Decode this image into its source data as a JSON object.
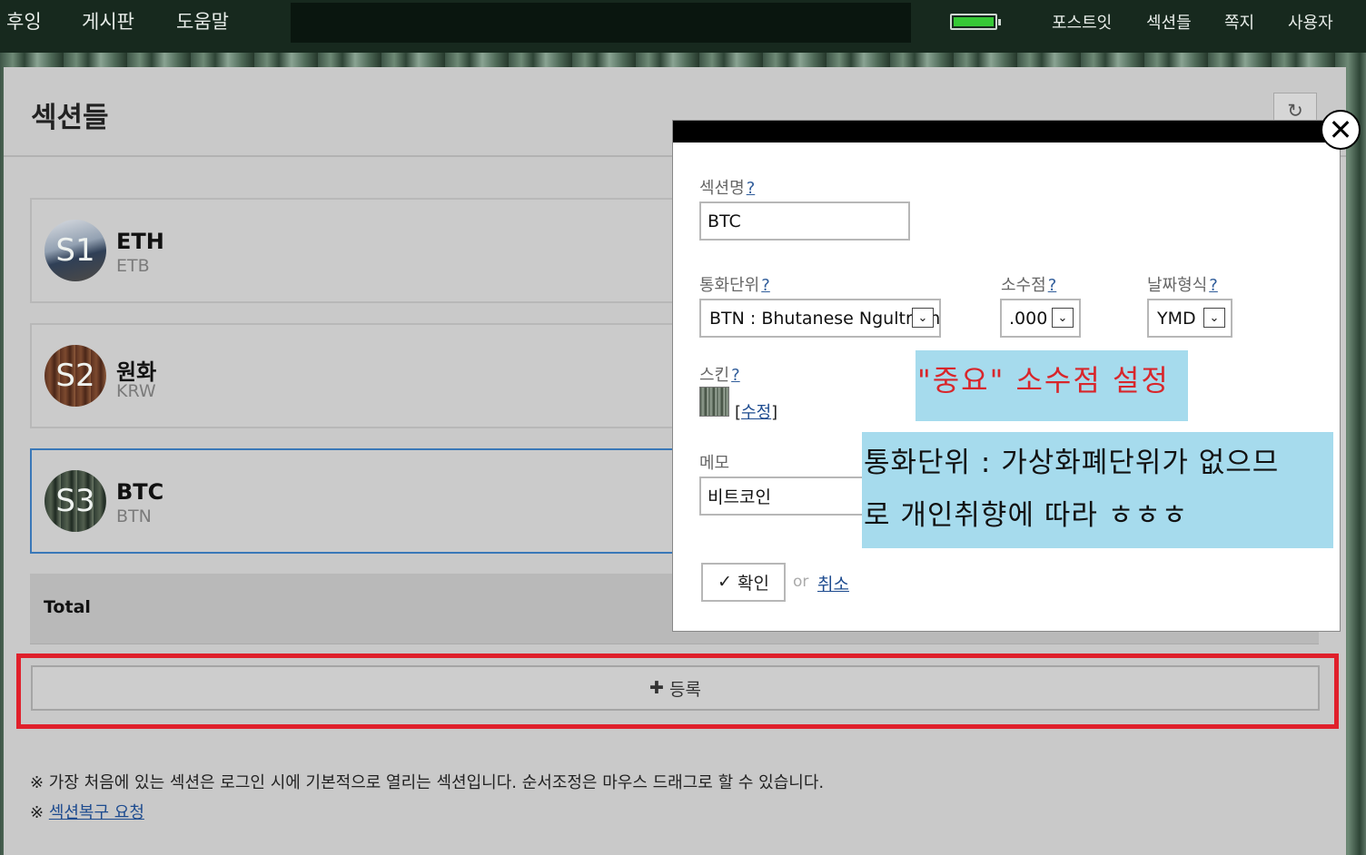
{
  "nav": {
    "items": [
      "후잉",
      "게시판",
      "도움말"
    ],
    "right_items": [
      "포스트잇",
      "섹션들",
      "쪽지",
      "사용자"
    ],
    "battery_color": "#36c936"
  },
  "panel": {
    "title": "섹션들",
    "refresh_icon": "↻"
  },
  "sections": [
    {
      "badge": "S1",
      "name": "ETH",
      "code": "ETB"
    },
    {
      "badge": "S2",
      "name": "원화",
      "code": "KRW"
    },
    {
      "badge": "S3",
      "name": "BTC",
      "code": "BTN"
    }
  ],
  "total_label": "Total",
  "register": {
    "icon": "✚",
    "label": "등록",
    "highlight_color": "#e0202b"
  },
  "notes": {
    "line1": "※ 가장 처음에 있는 섹션은 로그인 시에 기본적으로 열리는 섹션입니다. 순서조정은 마우스 드래그로 할 수 있습니다.",
    "line2_prefix": "※ ",
    "line2_link": "섹션복구 요청"
  },
  "modal": {
    "close_icon": "✕",
    "help": "?",
    "section_name_label": "섹션명",
    "section_name_value": "BTC",
    "currency_label": "통화단위",
    "currency_value": "BTN : Bhutanese Ngultrum",
    "decimal_label": "소수점",
    "decimal_value": ".000",
    "date_label": "날짜형식",
    "date_value": "YMD",
    "select_arrow": "⌄",
    "skin_label": "스킨",
    "skin_edit_open": "[",
    "skin_edit_link": "수정",
    "skin_edit_close": "]",
    "memo_label": "메모",
    "memo_value": "비트코인",
    "ok_icon": "✓",
    "ok_label": "확인",
    "or_text": "or",
    "cancel_label": "취소"
  },
  "annotations": {
    "decimal_note": "\"중요\" 소수점 설정",
    "currency_note_line1": "통화단위 : 가상화폐단위가 없으므",
    "currency_note_line2": "로 개인취향에 따라 ㅎㅎㅎ"
  }
}
